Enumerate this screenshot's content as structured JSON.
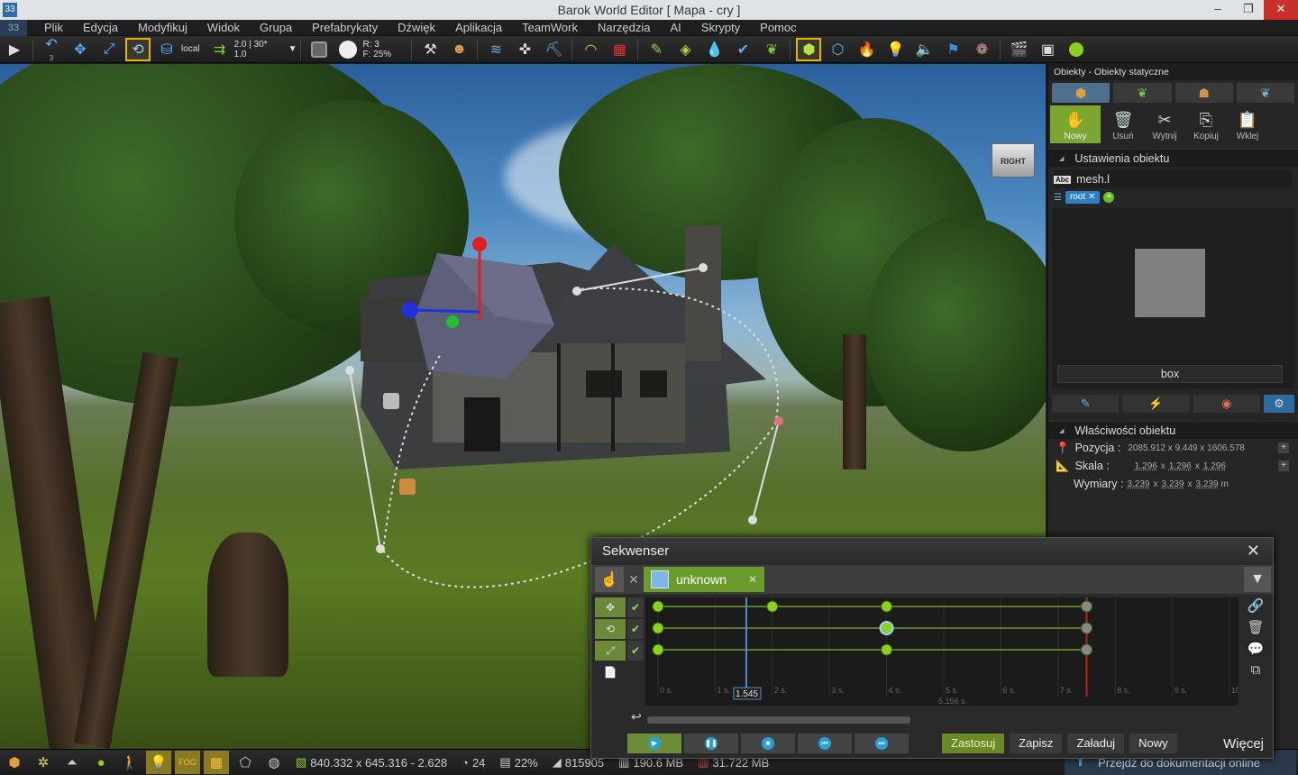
{
  "window": {
    "title": "Barok World Editor [ Mapa - cry ]",
    "app_icon": "33",
    "min": "–",
    "max": "❐",
    "close": "✕"
  },
  "menu": [
    "Plik",
    "Edycja",
    "Modyfikuj",
    "Widok",
    "Grupa",
    "Prefabrykaty",
    "Dźwięk",
    "Aplikacja",
    "TeamWork",
    "Narzędzia",
    "AI",
    "Skrypty",
    "Pomoc"
  ],
  "toolbar": {
    "coord_space": "local",
    "snap_top": "2.0 | 30*",
    "snap_bottom": "1.0",
    "undo_count": "3",
    "r_value": "R: 3",
    "f_value": "F: 25%"
  },
  "viewcube": {
    "label": "RIGHT"
  },
  "panel": {
    "title": "Obiekty - Obiekty statyczne",
    "actions": [
      "Nowy",
      "Usuń",
      "Wytnij",
      "Kopiuj",
      "Wklej"
    ],
    "settings_header": "Ustawienia obiektu",
    "object_name": "mesh.l",
    "tag": "root",
    "preview_label": "box",
    "props_header": "Właściwości obiektu",
    "position_label": "Pozycja :",
    "position_value": "2085.912 x 9.449 x 1606.578",
    "scale_label": "Skala :",
    "scale_x": "1.296",
    "scale_y": "1.296",
    "scale_z": "1.296",
    "dims_label": "Wymiary :",
    "dims_x": "3.239",
    "dims_y": "3.239",
    "dims_z": "3.239",
    "dims_unit": "m",
    "x_sep": "x",
    "abc": "Abc"
  },
  "sequencer": {
    "title": "Sekwenser",
    "object": "unknown",
    "current_time": "1.545",
    "duration": "5.156 s.",
    "ticks": [
      "0 s.",
      "1 s.",
      "2 s.",
      "3 s.",
      "4 s.",
      "5 s.",
      "6 s.",
      "7 s.",
      "8 s.",
      "9 s.",
      "10"
    ],
    "buttons": {
      "apply": "Zastosuj",
      "save": "Zapisz",
      "load": "Załaduj",
      "new": "Nowy"
    },
    "more": "Więcej",
    "keys": [
      [
        0,
        2,
        4,
        7.5
      ],
      [
        0,
        4,
        7.5
      ],
      [
        0,
        4,
        7.5
      ]
    ],
    "max_time": 10
  },
  "status": {
    "coords": "840.332 x 645.316 - 2.628",
    "fps": "24",
    "cpu": "22%",
    "tris": "815905",
    "mem1": "190.6 MB",
    "mem2": "31.722 MB",
    "docs": "Przejdź do dokumentacji online",
    "fog": "FOG"
  }
}
